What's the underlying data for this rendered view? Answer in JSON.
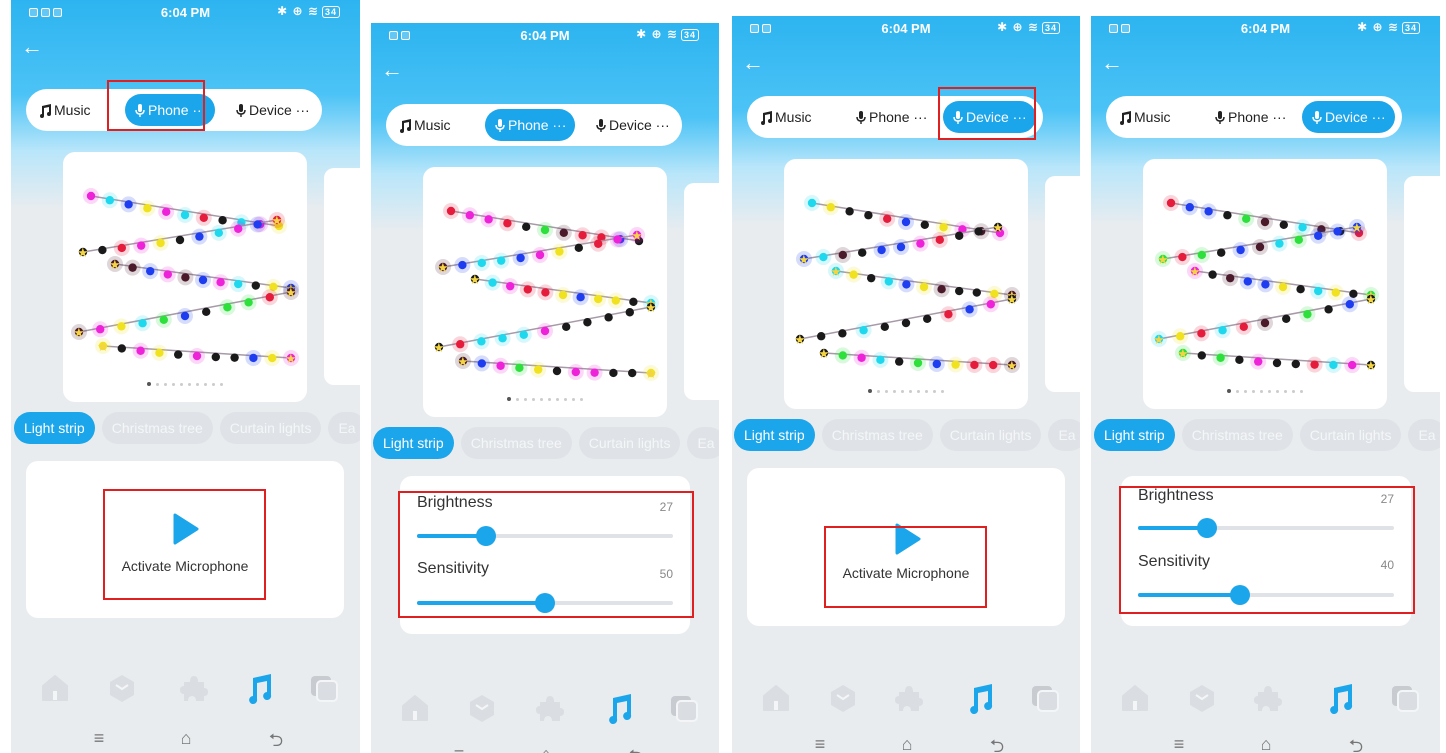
{
  "status": {
    "time": "6:04 PM",
    "battery": "34"
  },
  "mode_tabs": {
    "music": "Music",
    "phone": "Phone ···",
    "device": "Device ···"
  },
  "categories": [
    "Light strip",
    "Christmas tree",
    "Curtain lights",
    "Ea"
  ],
  "activate_mic": "Activate Microphone",
  "sliders": {
    "brightness_label": "Brightness",
    "sensitivity_label": "Sensitivity",
    "screen2": {
      "brightness": "27",
      "sensitivity": "50"
    },
    "screen4": {
      "brightness": "27",
      "sensitivity": "40"
    }
  },
  "icons": [
    "back-arrow-icon",
    "music-note-icon",
    "microphone-icon",
    "play-icon",
    "home-icon",
    "cube-icon",
    "puzzle-icon",
    "music-icon",
    "layers-icon",
    "menu-icon",
    "home-outline-icon",
    "return-icon"
  ],
  "colors": {
    "accent": "#1ba5ea",
    "highlight": "#e02020"
  }
}
